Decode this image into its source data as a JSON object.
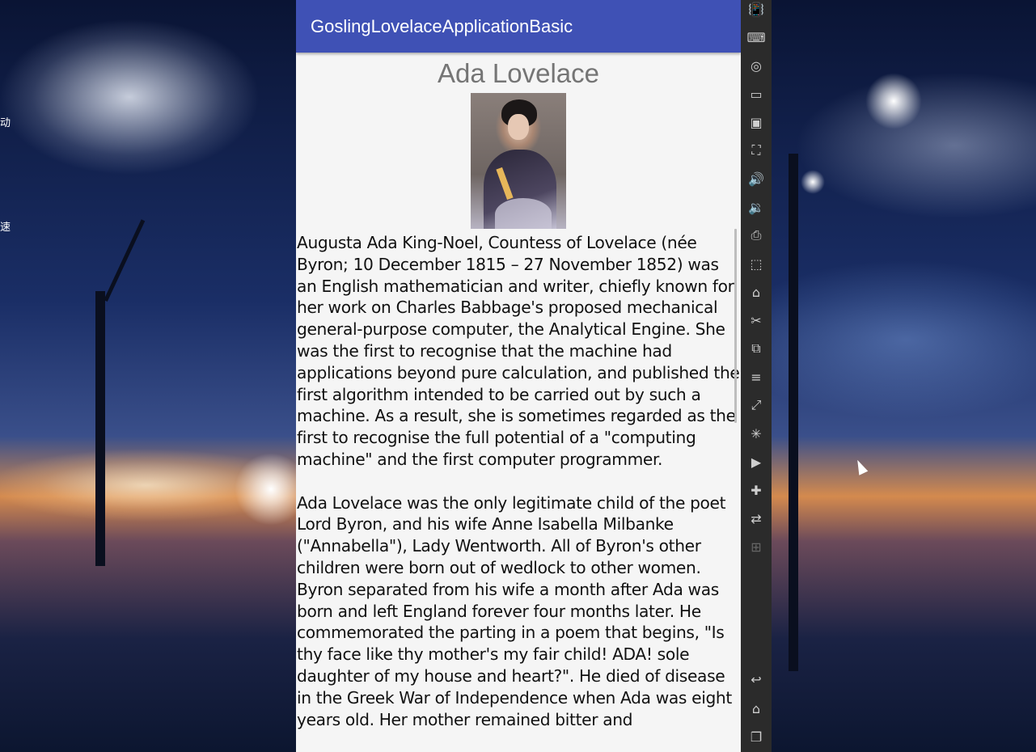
{
  "app": {
    "title": "GoslingLovelaceApplicationBasic"
  },
  "content": {
    "heading": "Ada Lovelace",
    "paragraphs": [
      "Augusta Ada King-Noel, Countess of Lovelace (née Byron; 10 December 1815 – 27 November 1852) was an English mathematician and writer, chiefly known for her work on Charles Babbage's proposed mechanical general-purpose computer, the Analytical Engine. She was the first to recognise that the machine had applications beyond pure calculation, and published the first algorithm intended to be carried out by such a machine. As a result, she is sometimes regarded as the first to recognise the full potential of a \"computing machine\" and the first computer programmer.",
      "Ada Lovelace was the only legitimate child of the poet Lord Byron, and his wife Anne Isabella Milbanke (\"Annabella\"), Lady Wentworth. All of Byron's other children were born out of wedlock to other women. Byron separated from his wife a month after Ada was born and left England forever four months later. He commemorated the parting in a poem that begins, \"Is thy face like thy mother's my fair child! ADA! sole daughter of my house and heart?\". He died of disease in the Greek War of Independence when Ada was eight years old. Her mother remained bitter and"
    ]
  },
  "desktop": {
    "side_chars": [
      "动",
      "速"
    ]
  },
  "toolbar": {
    "buttons": [
      {
        "name": "shake-icon",
        "glyph": "📳"
      },
      {
        "name": "keyboard-icon",
        "glyph": "⌨"
      },
      {
        "name": "location-icon",
        "glyph": "◎"
      },
      {
        "name": "screen-icon",
        "glyph": "▭"
      },
      {
        "name": "storage-icon",
        "glyph": "▣"
      },
      {
        "name": "fullscreen-icon",
        "glyph": "⛶"
      },
      {
        "name": "volume-up-icon",
        "glyph": "🔊"
      },
      {
        "name": "volume-down-icon",
        "glyph": "🔉"
      },
      {
        "name": "printer-icon",
        "glyph": "⎙"
      },
      {
        "name": "screenshot-icon",
        "glyph": "⬚"
      },
      {
        "name": "apk-icon",
        "glyph": "⌂"
      },
      {
        "name": "scissors-icon",
        "glyph": "✂"
      },
      {
        "name": "multi-window-icon",
        "glyph": "⧉"
      },
      {
        "name": "menu-icon",
        "glyph": "≡"
      },
      {
        "name": "resize-icon",
        "glyph": "⤢"
      },
      {
        "name": "loading-icon",
        "glyph": "✳"
      },
      {
        "name": "video-icon",
        "glyph": "▶"
      },
      {
        "name": "gamepad-icon",
        "glyph": "✚"
      },
      {
        "name": "swap-icon",
        "glyph": "⇄"
      },
      {
        "name": "add-icon",
        "glyph": "⊞"
      }
    ],
    "nav": [
      {
        "name": "back-icon",
        "glyph": "↩"
      },
      {
        "name": "home-icon",
        "glyph": "⌂"
      },
      {
        "name": "recents-icon",
        "glyph": "❐"
      }
    ]
  }
}
